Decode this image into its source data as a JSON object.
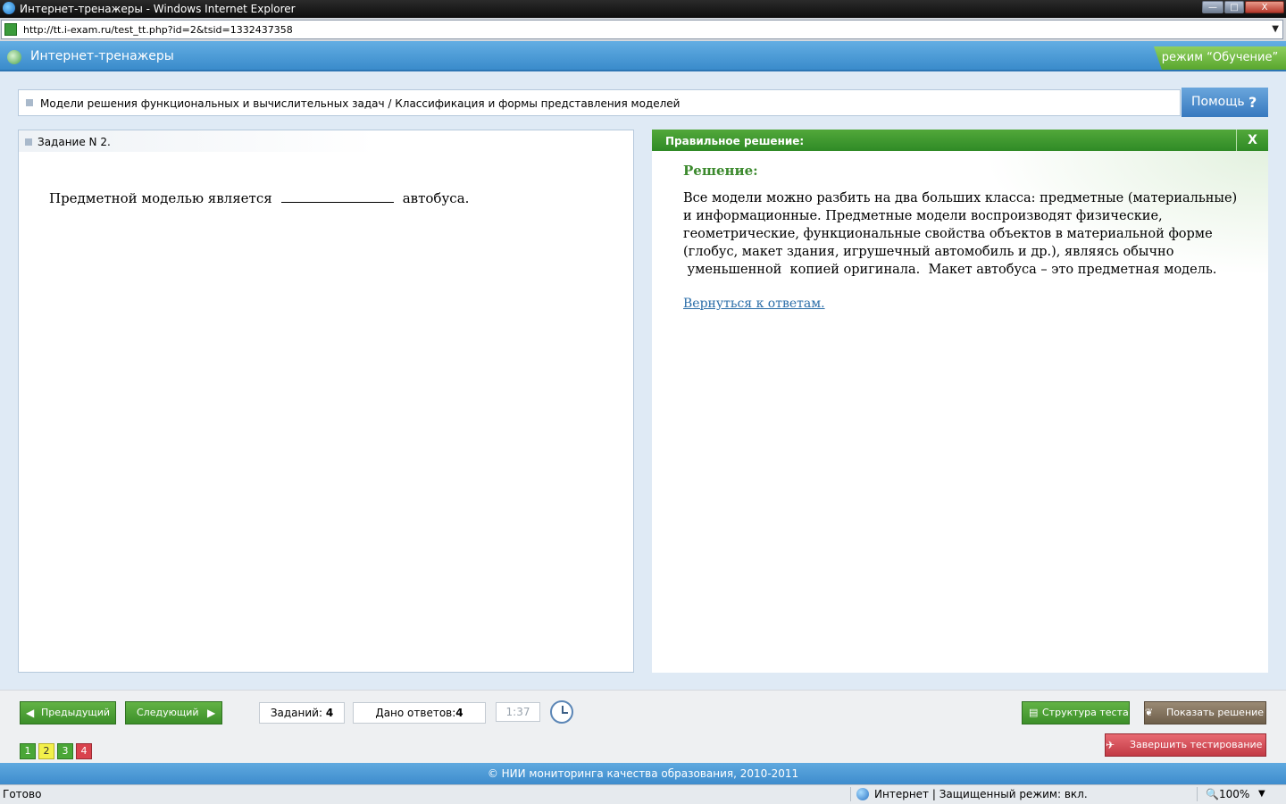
{
  "window": {
    "title": "Интернет-тренажеры - Windows Internet Explorer",
    "minimize_label": "—",
    "restore_label": "□",
    "close_label": "X"
  },
  "address": {
    "url": "http://tt.i-exam.ru/test_tt.php?id=2&tsid=1332437358"
  },
  "app": {
    "title": "Интернет-тренажеры",
    "mode": "режим “Обучение”"
  },
  "breadcrumb": {
    "text": "Модели решения функциональных и вычислительных задач / Классификация и формы представления моделей"
  },
  "help": {
    "label": "Помощь",
    "icon_label": "?"
  },
  "task": {
    "number": "Задание N 2.",
    "text_before": "Предметной моделью является",
    "text_after": "автобуса."
  },
  "solution": {
    "header": "Правильное решение:",
    "close_label": "X",
    "title": "Решение:",
    "lines": [
      "Все модели можно разбить на два больших класса: предметные (материальные)",
      "и информационные. Предметные модели воспроизводят физические,",
      "геометрические, функциональные свойства объектов в материальной форме",
      "(глобус, макет здания, игрушечный автомобиль и др.), являясь обычно",
      " уменьшенной  копией оригинала.  Макет автобуса – это предметная модель."
    ],
    "back_link": "Вернуться к ответам."
  },
  "nav": {
    "prev": "Предыдущий",
    "next": "Следующий",
    "tasks_label": "Заданий:",
    "tasks_count": "4",
    "answers_label": "Дано ответов:",
    "answers_count": "4",
    "timer": "1:37",
    "structure": "Структура теста",
    "show_solution": "Показать решение",
    "finish": "Завершить тестирование"
  },
  "pages": [
    {
      "label": "1",
      "state": "answered"
    },
    {
      "label": "2",
      "state": "current"
    },
    {
      "label": "3",
      "state": "answered"
    },
    {
      "label": "4",
      "state": "wrong"
    }
  ],
  "colors": {
    "answered_bg": "#4aa637",
    "current_bg": "#f3f04a",
    "wrong_bg": "#d9434e"
  },
  "footer": {
    "copyright": "© НИИ мониторинга качества образования, 2010-2011"
  },
  "status": {
    "ready": "Готово",
    "zone": "Интернет | Защищенный режим: вкл.",
    "zoom": "100%"
  }
}
